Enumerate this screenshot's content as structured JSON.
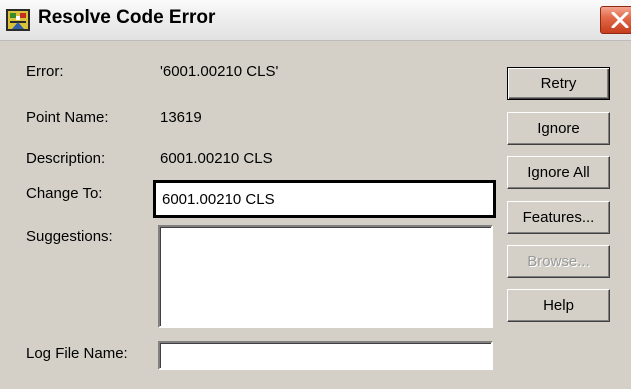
{
  "window": {
    "title": "Resolve Code Error",
    "title_icon": "survey-app-icon",
    "close_icon": "close-x-icon"
  },
  "fields": {
    "error_label": "Error:",
    "error_value": "'6001.00210 CLS'",
    "point_name_label": "Point Name:",
    "point_name_value": "13619",
    "description_label": "Description:",
    "description_value": "6001.00210 CLS",
    "change_to_label": "Change To:",
    "change_to_value": "6001.00210 CLS",
    "suggestions_label": "Suggestions:",
    "suggestions_items": [],
    "log_file_label": "Log File Name:",
    "log_file_value": ""
  },
  "buttons": {
    "retry": "Retry",
    "ignore": "Ignore",
    "ignore_all": "Ignore All",
    "features": "Features...",
    "browse": "Browse...",
    "help": "Help"
  },
  "colors": {
    "dialog_bg": "#d4d0c8",
    "close_button": "#d8532f",
    "disabled_text": "#9a9a9a"
  }
}
